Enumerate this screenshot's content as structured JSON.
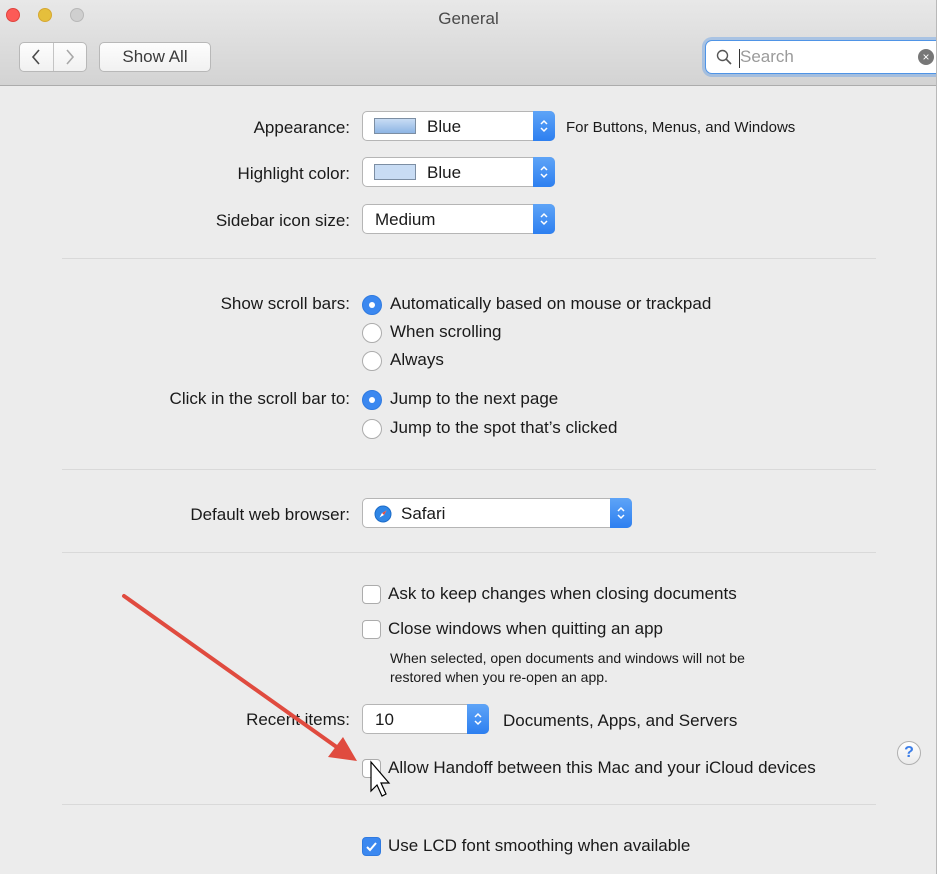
{
  "window": {
    "title": "General"
  },
  "toolbar": {
    "show_all_label": "Show All"
  },
  "search": {
    "placeholder": "Search",
    "value": ""
  },
  "appearance": {
    "label": "Appearance:",
    "value": "Blue",
    "note": "For Buttons, Menus, and Windows",
    "swatch_color": "#9cbfe8"
  },
  "highlight": {
    "label": "Highlight color:",
    "value": "Blue",
    "swatch_color": "#c8dcf4"
  },
  "sidebar_size": {
    "label": "Sidebar icon size:",
    "value": "Medium"
  },
  "scroll_bars": {
    "label": "Show scroll bars:",
    "options": [
      "Automatically based on mouse or trackpad",
      "When scrolling",
      "Always"
    ],
    "selected": 0
  },
  "click_scroll": {
    "label": "Click in the scroll bar to:",
    "options": [
      "Jump to the next page",
      "Jump to the spot that’s clicked"
    ],
    "selected": 0
  },
  "browser": {
    "label": "Default web browser:",
    "value": "Safari"
  },
  "ask_changes": {
    "label": "Ask to keep changes when closing documents",
    "checked": false
  },
  "close_windows": {
    "label": "Close windows when quitting an app",
    "checked": false,
    "note_line1": "When selected, open documents and windows will not be",
    "note_line2": "restored when you re-open an app."
  },
  "recent": {
    "label": "Recent items:",
    "value": "10",
    "note": "Documents, Apps, and Servers"
  },
  "handoff": {
    "label": "Allow Handoff between this Mac and your iCloud devices",
    "checked": false
  },
  "lcd": {
    "label": "Use LCD font smoothing when available",
    "checked": true
  },
  "help": {
    "label": "?"
  },
  "colors": {
    "accent": "#3b88f0",
    "annotation_arrow": "#e04b3f"
  }
}
